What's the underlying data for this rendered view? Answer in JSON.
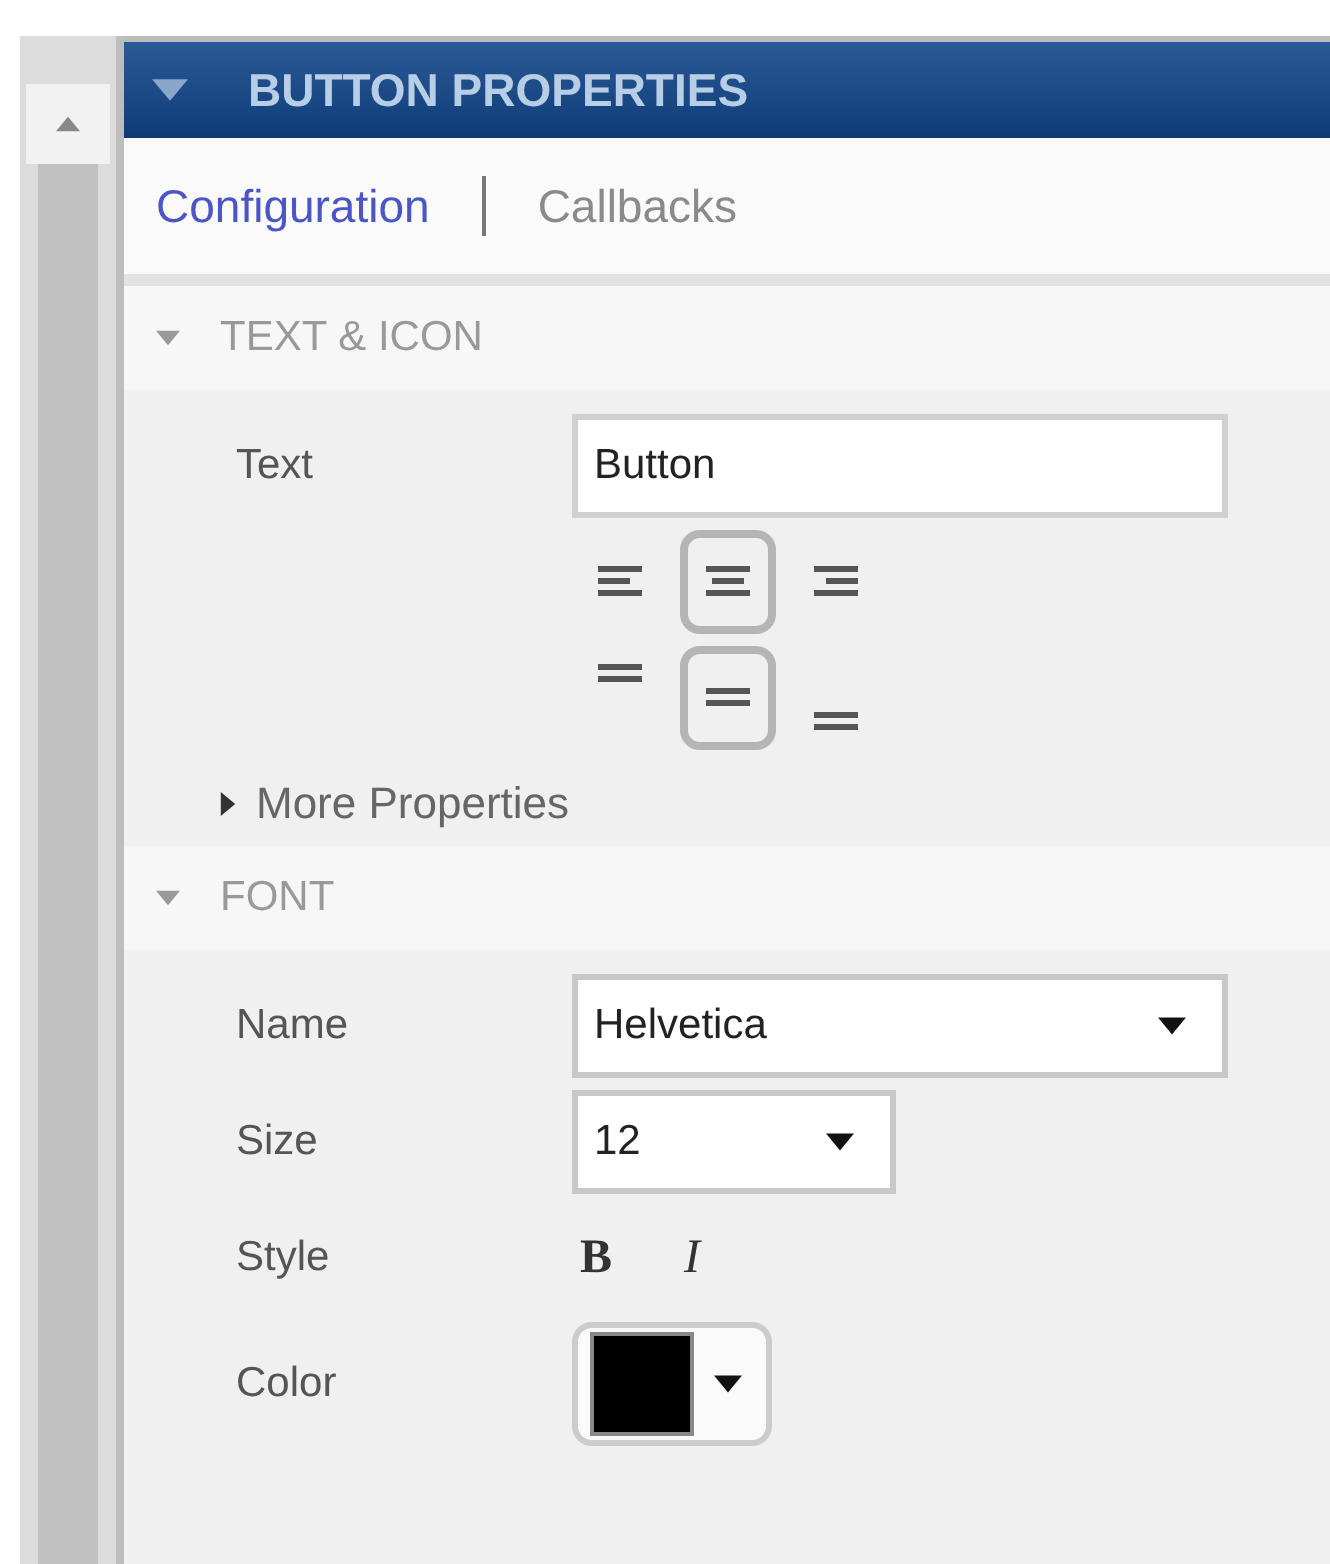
{
  "panel": {
    "title": "BUTTON PROPERTIES",
    "expanded": true
  },
  "tabs": [
    {
      "label": "Configuration",
      "selected": true
    },
    {
      "label": "Callbacks",
      "selected": false
    }
  ],
  "sections": [
    {
      "title": "TEXT & ICON",
      "expanded": true,
      "text_label": "Text",
      "text_value": "Button",
      "horizontal_align": [
        {
          "kind": "left",
          "selected": false
        },
        {
          "kind": "center",
          "selected": true
        },
        {
          "kind": "right",
          "selected": false
        }
      ],
      "vertical_align": [
        {
          "kind": "top",
          "selected": false
        },
        {
          "kind": "middle",
          "selected": true
        },
        {
          "kind": "bottom",
          "selected": false
        }
      ],
      "more": {
        "label": "More Properties",
        "expanded": false
      }
    },
    {
      "title": "FONT",
      "expanded": true,
      "name": {
        "label": "Name",
        "value": "Helvetica"
      },
      "size": {
        "label": "Size",
        "value": "12"
      },
      "style": {
        "label": "Style",
        "bold": "B",
        "italic": "I"
      },
      "color": {
        "label": "Color",
        "color": "#000000"
      }
    }
  ]
}
